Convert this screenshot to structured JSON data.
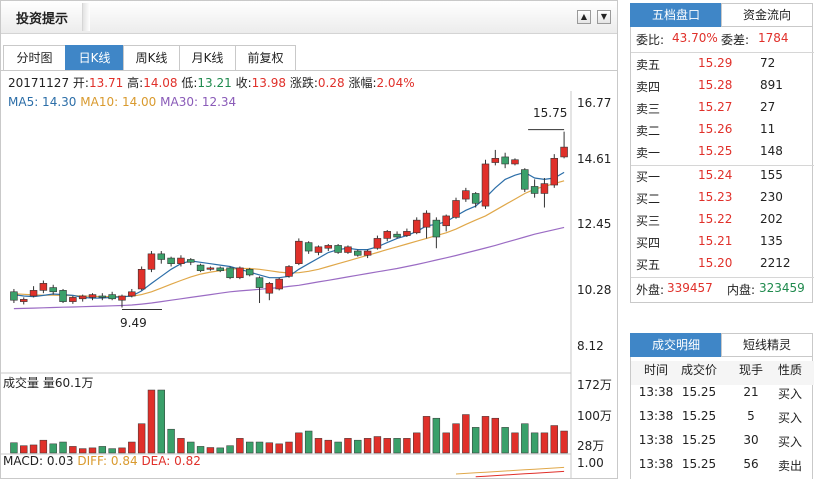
{
  "header": {
    "title": "投资提示",
    "up_symbol": "▲",
    "down_symbol": "▼"
  },
  "tabs": [
    "分时图",
    "日K线",
    "周K线",
    "月K线",
    "前复权"
  ],
  "active_tab": 1,
  "ohlc": {
    "date": "20171127",
    "open_label": "开:",
    "open": "13.71",
    "high_label": "高:",
    "high": "14.08",
    "low_label": "低:",
    "low": "13.21",
    "close_label": "收:",
    "close": "13.98",
    "change_label": "涨跌:",
    "change": "0.28",
    "pct_label": "涨幅:",
    "pct": "2.04%"
  },
  "ma": {
    "ma5": "MA5: 14.30",
    "ma10": "MA10: 14.00",
    "ma30": "MA30: 12.34"
  },
  "price_axis": [
    "16.77",
    "14.61",
    "12.45",
    "10.28",
    "8.12"
  ],
  "price_high_label": "15.75",
  "price_low_label": "9.49",
  "volume": {
    "title": "成交量 量60.1万",
    "axis": [
      "172万",
      "100万",
      "28万"
    ]
  },
  "macd": {
    "macd": "MACD: 0.03",
    "diff": "DIFF: 0.84",
    "dea": "DEA: 0.82",
    "axis": "1.00"
  },
  "colors": {
    "up": "#e0302a",
    "down": "#3aa06a",
    "ma5": "#2c6ea8",
    "ma10": "#e0a84a",
    "ma30": "#9b6cc4",
    "accent": "#3f86c7"
  },
  "chart_data": {
    "type": "candlestick",
    "ylim": [
      8.12,
      16.77
    ],
    "candles": [
      {
        "o": 10.05,
        "c": 9.75,
        "h": 10.15,
        "l": 9.65
      },
      {
        "o": 9.7,
        "c": 9.78,
        "h": 9.85,
        "l": 9.6
      },
      {
        "o": 9.9,
        "c": 10.1,
        "h": 10.25,
        "l": 9.85
      },
      {
        "o": 10.1,
        "c": 10.35,
        "h": 10.45,
        "l": 10.0
      },
      {
        "o": 10.2,
        "c": 10.05,
        "h": 10.3,
        "l": 9.95
      },
      {
        "o": 10.1,
        "c": 9.7,
        "h": 10.15,
        "l": 9.65
      },
      {
        "o": 9.7,
        "c": 9.85,
        "h": 9.9,
        "l": 9.62
      },
      {
        "o": 9.8,
        "c": 9.9,
        "h": 9.95,
        "l": 9.7
      },
      {
        "o": 9.85,
        "c": 9.95,
        "h": 10.0,
        "l": 9.75
      },
      {
        "o": 9.9,
        "c": 9.85,
        "h": 10.0,
        "l": 9.75
      },
      {
        "o": 9.95,
        "c": 9.8,
        "h": 10.05,
        "l": 9.75
      },
      {
        "o": 9.75,
        "c": 9.9,
        "h": 9.95,
        "l": 9.49
      },
      {
        "o": 9.9,
        "c": 10.05,
        "h": 10.15,
        "l": 9.85
      },
      {
        "o": 10.15,
        "c": 10.85,
        "h": 10.95,
        "l": 10.1
      },
      {
        "o": 10.85,
        "c": 11.4,
        "h": 11.5,
        "l": 10.75
      },
      {
        "o": 11.4,
        "c": 11.2,
        "h": 11.5,
        "l": 11.05
      },
      {
        "o": 11.25,
        "c": 11.05,
        "h": 11.3,
        "l": 10.95
      },
      {
        "o": 11.05,
        "c": 11.25,
        "h": 11.35,
        "l": 10.95
      },
      {
        "o": 11.2,
        "c": 11.1,
        "h": 11.25,
        "l": 11.0
      },
      {
        "o": 11.0,
        "c": 10.8,
        "h": 11.05,
        "l": 10.75
      },
      {
        "o": 10.85,
        "c": 10.9,
        "h": 10.95,
        "l": 10.8
      },
      {
        "o": 10.9,
        "c": 10.8,
        "h": 10.95,
        "l": 10.75
      },
      {
        "o": 10.9,
        "c": 10.55,
        "h": 10.95,
        "l": 10.5
      },
      {
        "o": 10.55,
        "c": 10.9,
        "h": 10.95,
        "l": 10.5
      },
      {
        "o": 10.85,
        "c": 10.65,
        "h": 10.9,
        "l": 10.6
      },
      {
        "o": 10.55,
        "c": 10.2,
        "h": 10.6,
        "l": 9.65
      },
      {
        "o": 10.0,
        "c": 10.35,
        "h": 10.4,
        "l": 9.75
      },
      {
        "o": 10.15,
        "c": 10.5,
        "h": 10.55,
        "l": 10.1
      },
      {
        "o": 10.6,
        "c": 10.95,
        "h": 11.0,
        "l": 10.55
      },
      {
        "o": 11.05,
        "c": 11.85,
        "h": 11.95,
        "l": 11.0
      },
      {
        "o": 11.8,
        "c": 11.5,
        "h": 11.85,
        "l": 11.4
      },
      {
        "o": 11.45,
        "c": 11.65,
        "h": 11.7,
        "l": 11.35
      },
      {
        "o": 11.6,
        "c": 11.7,
        "h": 11.75,
        "l": 11.5
      },
      {
        "o": 11.7,
        "c": 11.45,
        "h": 11.75,
        "l": 11.4
      },
      {
        "o": 11.45,
        "c": 11.65,
        "h": 11.7,
        "l": 11.4
      },
      {
        "o": 11.5,
        "c": 11.35,
        "h": 11.55,
        "l": 11.3
      },
      {
        "o": 11.35,
        "c": 11.5,
        "h": 11.55,
        "l": 11.25
      },
      {
        "o": 11.6,
        "c": 11.95,
        "h": 12.05,
        "l": 11.55
      },
      {
        "o": 11.95,
        "c": 12.2,
        "h": 12.25,
        "l": 11.85
      },
      {
        "o": 12.1,
        "c": 12.0,
        "h": 12.2,
        "l": 11.95
      },
      {
        "o": 12.05,
        "c": 12.2,
        "h": 12.3,
        "l": 12.0
      },
      {
        "o": 12.15,
        "c": 12.6,
        "h": 12.7,
        "l": 12.1
      },
      {
        "o": 12.35,
        "c": 12.85,
        "h": 12.95,
        "l": 11.95
      },
      {
        "o": 12.6,
        "c": 12.0,
        "h": 12.7,
        "l": 11.6
      },
      {
        "o": 12.4,
        "c": 12.75,
        "h": 12.8,
        "l": 12.2
      },
      {
        "o": 12.7,
        "c": 13.3,
        "h": 13.4,
        "l": 12.65
      },
      {
        "o": 13.35,
        "c": 13.65,
        "h": 13.75,
        "l": 13.25
      },
      {
        "o": 13.55,
        "c": 13.2,
        "h": 13.6,
        "l": 13.05
      },
      {
        "o": 13.1,
        "c": 14.6,
        "h": 14.75,
        "l": 13.0
      },
      {
        "o": 14.65,
        "c": 14.8,
        "h": 15.1,
        "l": 14.55
      },
      {
        "o": 14.85,
        "c": 14.6,
        "h": 15.0,
        "l": 14.45
      },
      {
        "o": 14.6,
        "c": 14.75,
        "h": 14.8,
        "l": 14.55
      },
      {
        "o": 14.4,
        "c": 13.7,
        "h": 14.45,
        "l": 13.6
      },
      {
        "o": 13.8,
        "c": 13.55,
        "h": 14.05,
        "l": 13.4
      },
      {
        "o": 13.55,
        "c": 13.9,
        "h": 14.1,
        "l": 13.05
      },
      {
        "o": 13.85,
        "c": 14.8,
        "h": 14.95,
        "l": 13.75
      },
      {
        "o": 14.85,
        "c": 15.2,
        "h": 15.75,
        "l": 14.8
      }
    ],
    "ma5": [
      9.95,
      9.9,
      9.88,
      9.92,
      9.97,
      9.95,
      9.92,
      9.85,
      9.82,
      9.83,
      9.85,
      9.87,
      9.9,
      10.08,
      10.35,
      10.6,
      10.85,
      11.05,
      11.15,
      11.1,
      11.05,
      11.0,
      10.95,
      10.85,
      10.75,
      10.65,
      10.55,
      10.55,
      10.6,
      10.85,
      11.05,
      11.25,
      11.45,
      11.55,
      11.6,
      11.55,
      11.55,
      11.65,
      11.8,
      11.95,
      12.05,
      12.2,
      12.4,
      12.45,
      12.55,
      12.75,
      12.95,
      13.1,
      13.4,
      13.75,
      14.05,
      14.2,
      14.3,
      14.1,
      14.05,
      14.1,
      14.3
    ],
    "ma10": [
      9.98,
      9.96,
      9.94,
      9.93,
      9.93,
      9.92,
      9.91,
      9.9,
      9.89,
      9.88,
      9.88,
      9.88,
      9.89,
      9.95,
      10.05,
      10.18,
      10.32,
      10.45,
      10.58,
      10.68,
      10.75,
      10.8,
      10.85,
      10.88,
      10.88,
      10.85,
      10.8,
      10.75,
      10.72,
      10.73,
      10.78,
      10.85,
      10.95,
      11.05,
      11.15,
      11.25,
      11.35,
      11.45,
      11.55,
      11.65,
      11.75,
      11.85,
      11.95,
      12.05,
      12.15,
      12.28,
      12.45,
      12.6,
      12.75,
      12.95,
      13.15,
      13.35,
      13.55,
      13.7,
      13.8,
      13.9,
      14.0
    ],
    "ma30": [
      9.45,
      9.46,
      9.47,
      9.48,
      9.49,
      9.5,
      9.51,
      9.52,
      9.53,
      9.54,
      9.55,
      9.56,
      9.58,
      9.61,
      9.65,
      9.7,
      9.75,
      9.8,
      9.85,
      9.9,
      9.95,
      10.0,
      10.05,
      10.08,
      10.11,
      10.14,
      10.17,
      10.2,
      10.24,
      10.28,
      10.34,
      10.4,
      10.46,
      10.52,
      10.58,
      10.64,
      10.7,
      10.76,
      10.82,
      10.88,
      10.95,
      11.02,
      11.1,
      11.18,
      11.26,
      11.34,
      11.43,
      11.52,
      11.61,
      11.7,
      11.8,
      11.9,
      12.0,
      12.1,
      12.18,
      12.26,
      12.34
    ],
    "volume_axis_max": 172,
    "volumes": [
      28,
      20,
      22,
      35,
      25,
      30,
      18,
      12,
      14,
      18,
      12,
      14,
      30,
      80,
      172,
      172,
      65,
      40,
      30,
      18,
      15,
      14,
      20,
      40,
      30,
      30,
      28,
      25,
      30,
      55,
      60,
      40,
      35,
      30,
      40,
      35,
      40,
      45,
      40,
      40,
      40,
      55,
      100,
      95,
      55,
      80,
      105,
      70,
      100,
      95,
      70,
      55,
      80,
      55,
      55,
      75,
      60
    ],
    "macd_axis_top": 1.0
  },
  "right": {
    "tabs": [
      "五档盘口",
      "资金流向"
    ],
    "webi_label": "委比:",
    "webi": "43.70%",
    "weicha_label": "委差:",
    "weicha": "1784",
    "sells": [
      {
        "label": "卖五",
        "price": "15.29",
        "vol": "72"
      },
      {
        "label": "卖四",
        "price": "15.28",
        "vol": "891"
      },
      {
        "label": "卖三",
        "price": "15.27",
        "vol": "27"
      },
      {
        "label": "卖二",
        "price": "15.26",
        "vol": "11"
      },
      {
        "label": "卖一",
        "price": "15.25",
        "vol": "148"
      }
    ],
    "buys": [
      {
        "label": "买一",
        "price": "15.24",
        "vol": "155"
      },
      {
        "label": "买二",
        "price": "15.23",
        "vol": "230"
      },
      {
        "label": "买三",
        "price": "15.22",
        "vol": "202"
      },
      {
        "label": "买四",
        "price": "15.21",
        "vol": "135"
      },
      {
        "label": "买五",
        "price": "15.20",
        "vol": "2212"
      }
    ],
    "waipan_label": "外盘:",
    "waipan": "339457",
    "neipan_label": "内盘:",
    "neipan": "323459",
    "trade_tabs": [
      "成交明细",
      "短线精灵"
    ],
    "trade_headers": [
      "时间",
      "成交价",
      "现手",
      "性质"
    ],
    "trades": [
      [
        "13:38",
        "15.25",
        "21",
        "买入"
      ],
      [
        "13:38",
        "15.25",
        "5",
        "买入"
      ],
      [
        "13:38",
        "15.25",
        "30",
        "买入"
      ],
      [
        "13:38",
        "15.25",
        "56",
        "卖出"
      ]
    ]
  }
}
